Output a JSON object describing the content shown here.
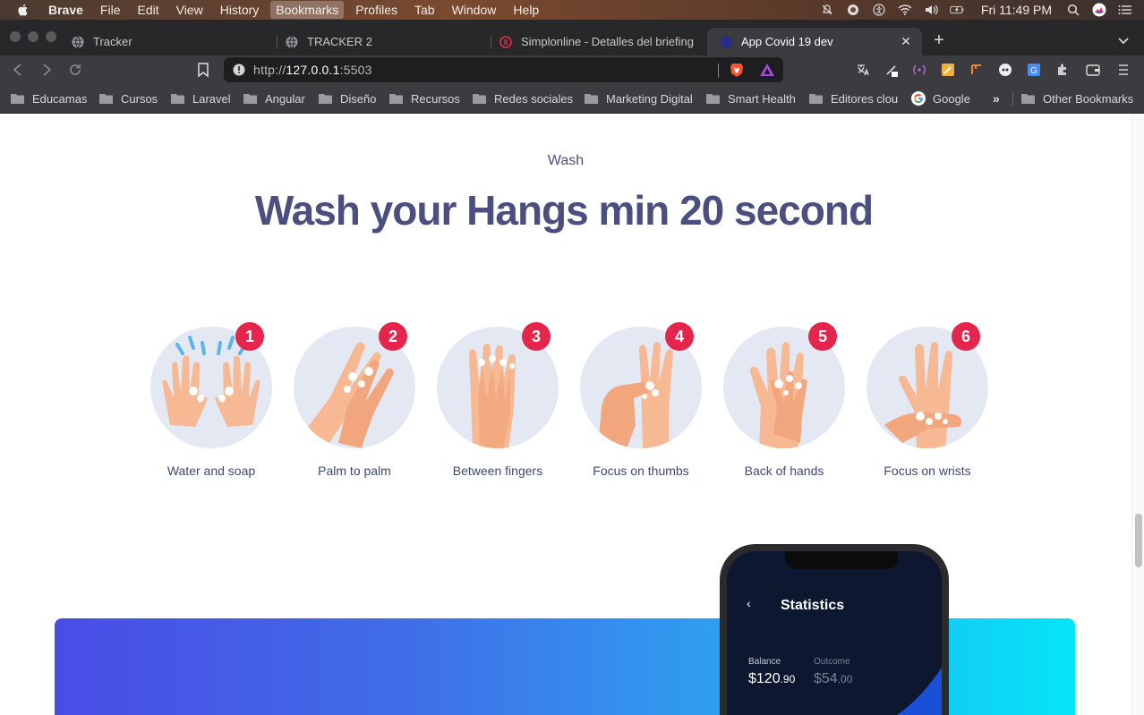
{
  "menubar": {
    "app": "Brave",
    "items": [
      "File",
      "Edit",
      "View",
      "History",
      "Bookmarks",
      "Profiles",
      "Tab",
      "Window",
      "Help"
    ],
    "active_item": "Bookmarks",
    "clock": "Fri 11:49 PM"
  },
  "tabs": [
    {
      "title": "Tracker",
      "icon": "globe-icon"
    },
    {
      "title": "TRACKER 2",
      "icon": "globe-icon"
    },
    {
      "title": "Simplonline - Detalles del briefing",
      "icon": "simplon-icon"
    },
    {
      "title": "App Covid 19 dev",
      "icon": "covid-app-icon",
      "active": true
    }
  ],
  "toolbar": {
    "url_prefix": "http://",
    "url_host": "127.0.0.1",
    "url_port": ":5503"
  },
  "bookmarks": [
    {
      "label": "Educamas"
    },
    {
      "label": "Cursos"
    },
    {
      "label": "Laravel"
    },
    {
      "label": "Angular"
    },
    {
      "label": "Diseño"
    },
    {
      "label": "Recursos"
    },
    {
      "label": "Redes sociales"
    },
    {
      "label": "Marketing Digital"
    },
    {
      "label": "Smart Health"
    },
    {
      "label": "Editores clou"
    },
    {
      "label": "Google"
    }
  ],
  "bookmarks_more": "»",
  "other_bookmarks": "Other Bookmarks",
  "page": {
    "eyebrow": "Wash",
    "headline": "Wash your Hangs min 20 second",
    "steps": [
      {
        "number": "1",
        "label": "Water and soap"
      },
      {
        "number": "2",
        "label": "Palm to palm"
      },
      {
        "number": "3",
        "label": "Between fingers"
      },
      {
        "number": "4",
        "label": "Focus on thumbs"
      },
      {
        "number": "5",
        "label": "Back of hands"
      },
      {
        "number": "6",
        "label": "Focus on wrists"
      }
    ]
  },
  "phone": {
    "back": "‹",
    "title": "Statistics",
    "balance_label": "Balance",
    "balance_value": "$120",
    "balance_cents": ".90",
    "outcome_label": "Outcome",
    "outcome_value": "$54",
    "outcome_cents": ".00"
  },
  "colors": {
    "headline": "#4a4f80",
    "badge": "#e5254c",
    "banner_start": "#4a4ce6",
    "banner_end": "#04e6f7",
    "skin": "#f7b993"
  }
}
